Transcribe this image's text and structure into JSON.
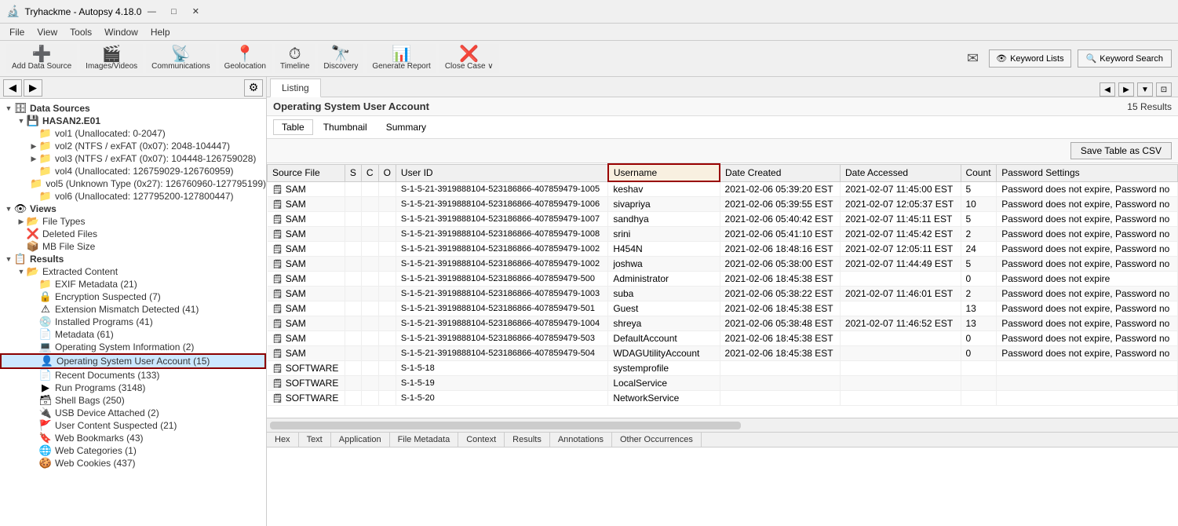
{
  "app": {
    "title": "Tryhackme - Autopsy 4.18.0",
    "icon": "🔬"
  },
  "titlebar": {
    "title": "Tryhackme - Autopsy 4.18.0",
    "minimize": "—",
    "maximize": "□",
    "close": "✕"
  },
  "menubar": {
    "items": [
      "File",
      "View",
      "Tools",
      "Window",
      "Help"
    ]
  },
  "toolbar": {
    "buttons": [
      {
        "id": "add-data-source",
        "icon": "➕",
        "label": "Add Data Source"
      },
      {
        "id": "images-videos",
        "icon": "🎬",
        "label": "Images/Videos"
      },
      {
        "id": "communications",
        "icon": "📡",
        "label": "Communications"
      },
      {
        "id": "geolocation",
        "icon": "📍",
        "label": "Geolocation"
      },
      {
        "id": "timeline",
        "icon": "⏱",
        "label": "Timeline"
      },
      {
        "id": "discovery",
        "icon": "🔭",
        "label": "Discovery"
      },
      {
        "id": "generate-report",
        "icon": "📊",
        "label": "Generate Report"
      },
      {
        "id": "close-case",
        "icon": "❌",
        "label": "Close Case ∨"
      }
    ],
    "keyword_lists": "Keyword Lists",
    "keyword_search": "Keyword Search"
  },
  "left_panel": {
    "tree": [
      {
        "level": 0,
        "icon": "🗄",
        "label": "Data Sources",
        "toggle": "▼",
        "bold": true
      },
      {
        "level": 1,
        "icon": "💾",
        "label": "HASAN2.E01",
        "toggle": "▼",
        "bold": true
      },
      {
        "level": 2,
        "icon": "📁",
        "label": "vol1 (Unallocated: 0-2047)",
        "toggle": ""
      },
      {
        "level": 2,
        "icon": "📁",
        "label": "vol2 (NTFS / exFAT (0x07): 2048-104447)",
        "toggle": "▶"
      },
      {
        "level": 2,
        "icon": "📁",
        "label": "vol3 (NTFS / exFAT (0x07): 104448-126759028)",
        "toggle": "▶"
      },
      {
        "level": 2,
        "icon": "📁",
        "label": "vol4 (Unallocated: 126759029-126760959)",
        "toggle": ""
      },
      {
        "level": 2,
        "icon": "📁",
        "label": "vol5 (Unknown Type (0x27): 126760960-127795199)",
        "toggle": ""
      },
      {
        "level": 2,
        "icon": "📁",
        "label": "vol6 (Unallocated: 127795200-127800447)",
        "toggle": ""
      },
      {
        "level": 0,
        "icon": "👁",
        "label": "Views",
        "toggle": "▼",
        "bold": true
      },
      {
        "level": 1,
        "icon": "📂",
        "label": "File Types",
        "toggle": "▶"
      },
      {
        "level": 1,
        "icon": "❌",
        "label": "Deleted Files",
        "toggle": ""
      },
      {
        "level": 1,
        "icon": "📦",
        "label": "MB File Size",
        "toggle": ""
      },
      {
        "level": 0,
        "icon": "📋",
        "label": "Results",
        "toggle": "▼",
        "bold": true
      },
      {
        "level": 1,
        "icon": "📂",
        "label": "Extracted Content",
        "toggle": "▼",
        "bold": false
      },
      {
        "level": 2,
        "icon": "📁",
        "label": "EXIF Metadata (21)",
        "toggle": ""
      },
      {
        "level": 2,
        "icon": "🔒",
        "label": "Encryption Suspected (7)",
        "toggle": ""
      },
      {
        "level": 2,
        "icon": "⚠",
        "label": "Extension Mismatch Detected (41)",
        "toggle": ""
      },
      {
        "level": 2,
        "icon": "💿",
        "label": "Installed Programs (41)",
        "toggle": ""
      },
      {
        "level": 2,
        "icon": "📄",
        "label": "Metadata (61)",
        "toggle": ""
      },
      {
        "level": 2,
        "icon": "💻",
        "label": "Operating System Information (2)",
        "toggle": ""
      },
      {
        "level": 2,
        "icon": "👤",
        "label": "Operating System User Account (15)",
        "toggle": "",
        "selected": true
      },
      {
        "level": 2,
        "icon": "📄",
        "label": "Recent Documents (133)",
        "toggle": ""
      },
      {
        "level": 2,
        "icon": "▶",
        "label": "Run Programs (3148)",
        "toggle": ""
      },
      {
        "level": 2,
        "icon": "🗃",
        "label": "Shell Bags (250)",
        "toggle": ""
      },
      {
        "level": 2,
        "icon": "🔌",
        "label": "USB Device Attached (2)",
        "toggle": ""
      },
      {
        "level": 2,
        "icon": "🚩",
        "label": "User Content Suspected (21)",
        "toggle": ""
      },
      {
        "level": 2,
        "icon": "🔖",
        "label": "Web Bookmarks (43)",
        "toggle": ""
      },
      {
        "level": 2,
        "icon": "🌐",
        "label": "Web Categories (1)",
        "toggle": ""
      },
      {
        "level": 2,
        "icon": "🍪",
        "label": "Web Cookies (437)",
        "toggle": ""
      }
    ]
  },
  "content": {
    "tab": "Listing",
    "section_title": "Operating System User Account",
    "results_count": "15 Results",
    "sub_tabs": [
      "Table",
      "Thumbnail",
      "Summary"
    ],
    "active_sub_tab": "Table",
    "save_button": "Save Table as CSV",
    "columns": [
      "Source File",
      "S",
      "C",
      "O",
      "User ID",
      "Username",
      "Date Created",
      "Date Accessed",
      "Count",
      "Password Settings"
    ],
    "rows": [
      {
        "source": "SAM",
        "s": "",
        "c": "",
        "o": "",
        "user_id": "S-1-5-21-3919888104-523186866-407859479-1005",
        "username": "keshav",
        "date_created": "2021-02-06 05:39:20 EST",
        "date_accessed": "2021-02-07 11:45:00 EST",
        "count": "5",
        "password": "Password does not expire, Password no"
      },
      {
        "source": "SAM",
        "s": "",
        "c": "",
        "o": "",
        "user_id": "S-1-5-21-3919888104-523186866-407859479-1006",
        "username": "sivapriya",
        "date_created": "2021-02-06 05:39:55 EST",
        "date_accessed": "2021-02-07 12:05:37 EST",
        "count": "10",
        "password": "Password does not expire, Password no"
      },
      {
        "source": "SAM",
        "s": "",
        "c": "",
        "o": "",
        "user_id": "S-1-5-21-3919888104-523186866-407859479-1007",
        "username": "sandhya",
        "date_created": "2021-02-06 05:40:42 EST",
        "date_accessed": "2021-02-07 11:45:11 EST",
        "count": "5",
        "password": "Password does not expire, Password no"
      },
      {
        "source": "SAM",
        "s": "",
        "c": "",
        "o": "",
        "user_id": "S-1-5-21-3919888104-523186866-407859479-1008",
        "username": "srini",
        "date_created": "2021-02-06 05:41:10 EST",
        "date_accessed": "2021-02-07 11:45:42 EST",
        "count": "2",
        "password": "Password does not expire, Password no"
      },
      {
        "source": "SAM",
        "s": "",
        "c": "",
        "o": "",
        "user_id": "S-1-5-21-3919888104-523186866-407859479-1002",
        "username": "H454N",
        "date_created": "2021-02-06 18:48:16 EST",
        "date_accessed": "2021-02-07 12:05:11 EST",
        "count": "24",
        "password": "Password does not expire, Password no"
      },
      {
        "source": "SAM",
        "s": "",
        "c": "",
        "o": "",
        "user_id": "S-1-5-21-3919888104-523186866-407859479-1002",
        "username": "joshwa",
        "date_created": "2021-02-06 05:38:00 EST",
        "date_accessed": "2021-02-07 11:44:49 EST",
        "count": "5",
        "password": "Password does not expire, Password no"
      },
      {
        "source": "SAM",
        "s": "",
        "c": "",
        "o": "",
        "user_id": "S-1-5-21-3919888104-523186866-407859479-500",
        "username": "Administrator",
        "date_created": "2021-02-06 18:45:38 EST",
        "date_accessed": "",
        "count": "0",
        "password": "Password does not expire"
      },
      {
        "source": "SAM",
        "s": "",
        "c": "",
        "o": "",
        "user_id": "S-1-5-21-3919888104-523186866-407859479-1003",
        "username": "suba",
        "date_created": "2021-02-06 05:38:22 EST",
        "date_accessed": "2021-02-07 11:46:01 EST",
        "count": "2",
        "password": "Password does not expire, Password no"
      },
      {
        "source": "SAM",
        "s": "",
        "c": "",
        "o": "",
        "user_id": "S-1-5-21-3919888104-523186866-407859479-501",
        "username": "Guest",
        "date_created": "2021-02-06 18:45:38 EST",
        "date_accessed": "",
        "count": "13",
        "password": "Password does not expire, Password no"
      },
      {
        "source": "SAM",
        "s": "",
        "c": "",
        "o": "",
        "user_id": "S-1-5-21-3919888104-523186866-407859479-1004",
        "username": "shreya",
        "date_created": "2021-02-06 05:38:48 EST",
        "date_accessed": "2021-02-07 11:46:52 EST",
        "count": "13",
        "password": "Password does not expire, Password no"
      },
      {
        "source": "SAM",
        "s": "",
        "c": "",
        "o": "",
        "user_id": "S-1-5-21-3919888104-523186866-407859479-503",
        "username": "DefaultAccount",
        "date_created": "2021-02-06 18:45:38 EST",
        "date_accessed": "",
        "count": "0",
        "password": "Password does not expire, Password no"
      },
      {
        "source": "SAM",
        "s": "",
        "c": "",
        "o": "",
        "user_id": "S-1-5-21-3919888104-523186866-407859479-504",
        "username": "WDAGUtilityAccount",
        "date_created": "2021-02-06 18:45:38 EST",
        "date_accessed": "",
        "count": "0",
        "password": "Password does not expire, Password no"
      },
      {
        "source": "SOFTWARE",
        "s": "",
        "c": "",
        "o": "",
        "user_id": "S-1-5-18",
        "username": "systemprofile",
        "date_created": "",
        "date_accessed": "",
        "count": "",
        "password": ""
      },
      {
        "source": "SOFTWARE",
        "s": "",
        "c": "",
        "o": "",
        "user_id": "S-1-5-19",
        "username": "LocalService",
        "date_created": "",
        "date_accessed": "",
        "count": "",
        "password": ""
      },
      {
        "source": "SOFTWARE",
        "s": "",
        "c": "",
        "o": "",
        "user_id": "S-1-5-20",
        "username": "NetworkService",
        "date_created": "",
        "date_accessed": "",
        "count": "",
        "password": ""
      }
    ]
  },
  "bottom_tabs": [
    "Hex",
    "Text",
    "Application",
    "File Metadata",
    "Context",
    "Results",
    "Annotations",
    "Other Occurrences"
  ]
}
